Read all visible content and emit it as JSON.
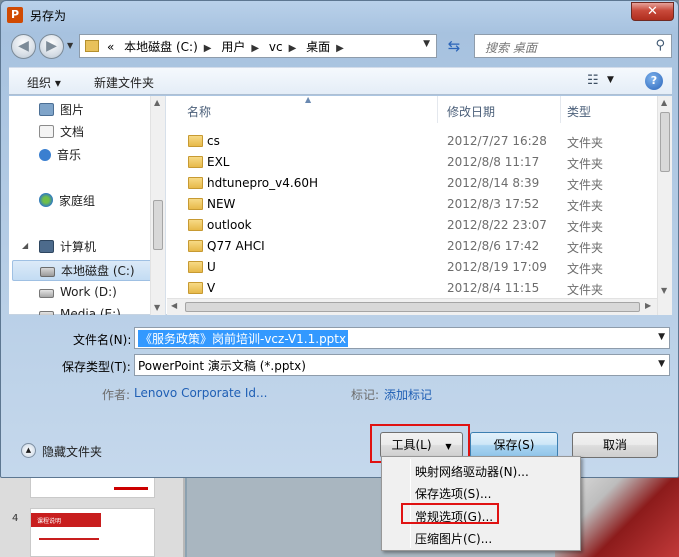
{
  "window": {
    "title": "另存为",
    "app_icon": "P",
    "close_label": "✕"
  },
  "address": {
    "prefix": "«",
    "crumbs": [
      "本地磁盘 (C:)",
      "用户",
      "vc",
      "桌面"
    ],
    "search_placeholder": "搜索 桌面"
  },
  "toolbar": {
    "organize": "组织 ▾",
    "new_folder": "新建文件夹"
  },
  "nav": {
    "items": [
      {
        "label": "图片",
        "icon": "pictures-icon"
      },
      {
        "label": "文档",
        "icon": "documents-icon"
      },
      {
        "label": "音乐",
        "icon": "music-icon"
      },
      {
        "label": "家庭组",
        "icon": "homegroup-icon"
      },
      {
        "label": "计算机",
        "icon": "computer-icon"
      },
      {
        "label": "本地磁盘 (C:)",
        "icon": "drive-icon",
        "selected": true
      },
      {
        "label": "Work (D:)",
        "icon": "drive-icon"
      },
      {
        "label": "Media (E:)",
        "icon": "drive-icon"
      }
    ]
  },
  "columns": {
    "name": "名称",
    "date": "修改日期",
    "type": "类型"
  },
  "files": [
    {
      "name": "cs",
      "date": "2012/7/27 16:28",
      "type": "文件夹"
    },
    {
      "name": "EXL",
      "date": "2012/8/8 11:17",
      "type": "文件夹"
    },
    {
      "name": "hdtunepro_v4.60H",
      "date": "2012/8/14 8:39",
      "type": "文件夹"
    },
    {
      "name": "NEW",
      "date": "2012/8/3 17:52",
      "type": "文件夹"
    },
    {
      "name": "outlook",
      "date": "2012/8/22 23:07",
      "type": "文件夹"
    },
    {
      "name": "Q77 AHCI",
      "date": "2012/8/6 17:42",
      "type": "文件夹"
    },
    {
      "name": "U",
      "date": "2012/8/19 17:09",
      "type": "文件夹"
    },
    {
      "name": "V",
      "date": "2012/8/4 11:15",
      "type": "文件夹"
    }
  ],
  "form": {
    "filename_label": "文件名(N):",
    "filename_value": "《服务政策》岗前培训-vcz-V1.1.pptx",
    "filetype_label": "保存类型(T):",
    "filetype_value": "PowerPoint 演示文稿 (*.pptx)",
    "author_label": "作者:",
    "author_value": "Lenovo Corporate Id...",
    "tags_label": "标记:",
    "tags_value": "添加标记"
  },
  "footer": {
    "hide_folders": "隐藏文件夹",
    "tools": "工具(L)",
    "save": "保存(S)",
    "cancel": "取消"
  },
  "tools_menu": [
    "映射网络驱动器(N)...",
    "保存选项(S)...",
    "常规选项(G)...",
    "压缩图片(C)..."
  ],
  "background": {
    "slide_number": "4",
    "thumb_header": "课程说明",
    "thumb_text": "第一节 服务政策的理念"
  }
}
